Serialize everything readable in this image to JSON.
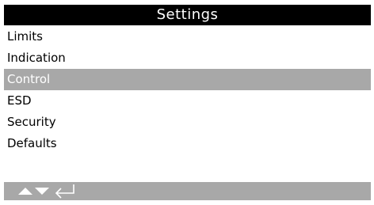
{
  "header": {
    "title": "Settings"
  },
  "menu": {
    "items": [
      {
        "label": "Limits"
      },
      {
        "label": "Indication"
      },
      {
        "label": "Control"
      },
      {
        "label": "ESD"
      },
      {
        "label": "Security"
      },
      {
        "label": "Defaults"
      }
    ],
    "selected_index": 2
  },
  "footer": {
    "icons": [
      "up-arrow-icon",
      "down-arrow-icon",
      "enter-icon"
    ]
  },
  "colors": {
    "title_background": "#000000",
    "title_text": "#ffffff",
    "selection_background": "#a8a8a8",
    "selection_text": "#ffffff",
    "footer_background": "#a8a8a8"
  }
}
